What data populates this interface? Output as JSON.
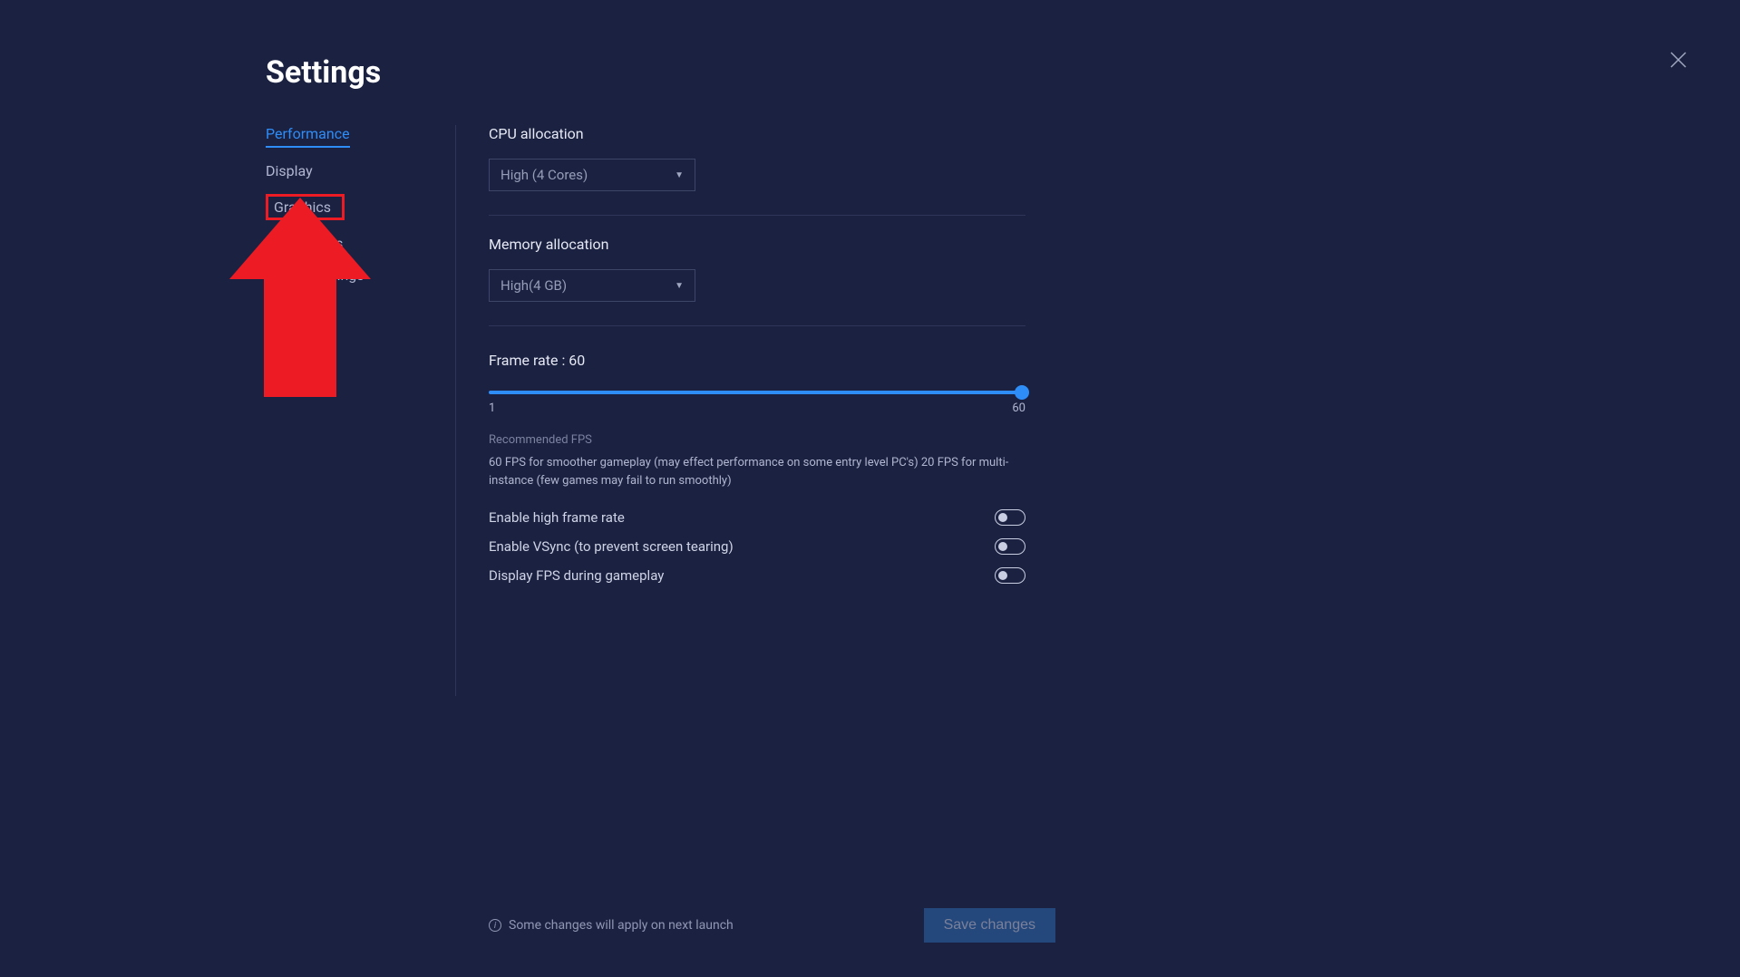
{
  "header": {
    "title": "Settings"
  },
  "sidebar": {
    "items": [
      {
        "label": "Performance"
      },
      {
        "label": "Display"
      },
      {
        "label": "Graphics"
      },
      {
        "label": "Preferences"
      },
      {
        "label": "Device settings"
      }
    ]
  },
  "main": {
    "cpu": {
      "label": "CPU allocation",
      "value": "High (4 Cores)"
    },
    "memory": {
      "label": "Memory allocation",
      "value": "High(4 GB)"
    },
    "frameRate": {
      "label": "Frame rate : 60",
      "min": "1",
      "max": "60",
      "recTitle": "Recommended FPS",
      "recText": "60 FPS for smoother gameplay (may effect performance on some entry level PC's) 20 FPS for multi-instance (few games may fail to run smoothly)"
    },
    "toggles": [
      {
        "label": "Enable high frame rate"
      },
      {
        "label": "Enable VSync (to prevent screen tearing)"
      },
      {
        "label": "Display FPS during gameplay"
      }
    ]
  },
  "footer": {
    "note": "Some changes will apply on next launch",
    "save": "Save changes"
  }
}
